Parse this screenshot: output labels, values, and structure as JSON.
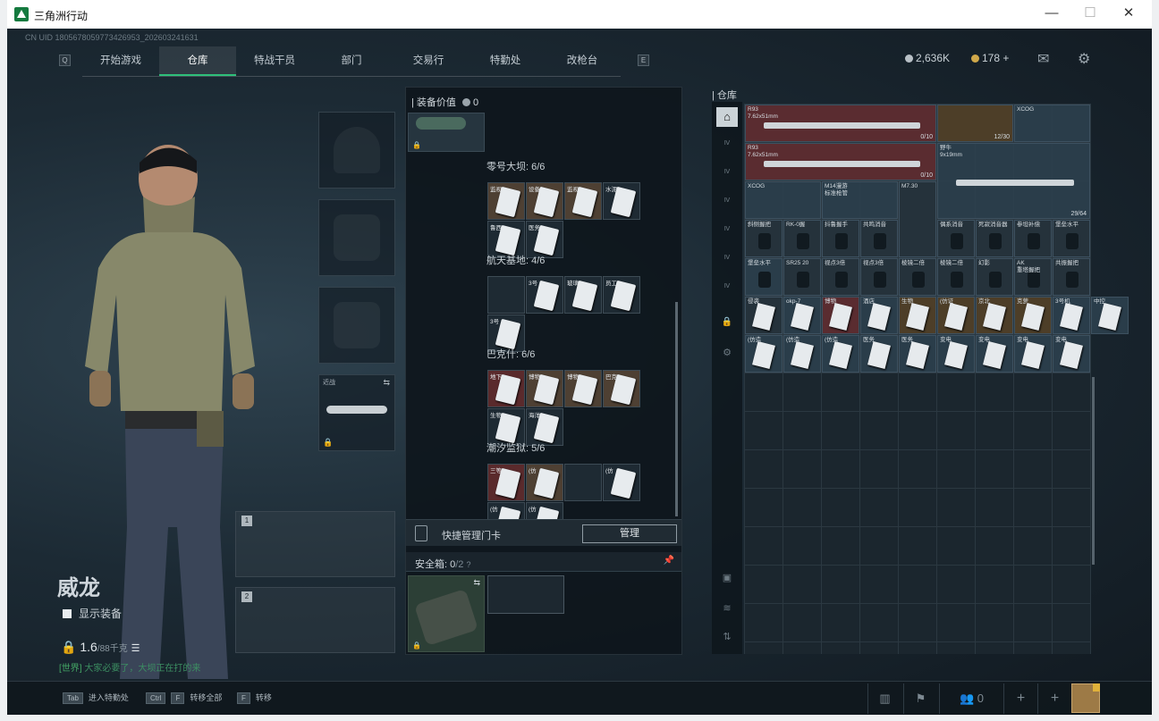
{
  "window": {
    "title": "三角洲行动",
    "min": "—",
    "max": "☐",
    "close": "✕"
  },
  "uid": "CN UID 1805678059773426953_202603241631",
  "nav": {
    "left_key": "Q",
    "right_key": "E",
    "tabs": [
      "开始游戏",
      "仓库",
      "特战干员",
      "部门",
      "交易行",
      "特勤处",
      "改枪台"
    ],
    "active": 1,
    "marked": [
      2,
      5
    ]
  },
  "currency": {
    "coins": "2,636K",
    "tokens": "178",
    "plus": "+"
  },
  "icons": {
    "mail": "mail-icon",
    "settings": "gear-icon"
  },
  "character": {
    "name": "威龙",
    "show_equipment": "显示装备",
    "weight": "1.6",
    "weight_max": "/88千克"
  },
  "chat": {
    "channel": "[世界]",
    "message": "大家必要了，大坝正在打的来"
  },
  "melee": {
    "label": "近战"
  },
  "weapon_slots": [
    "1",
    "2"
  ],
  "equip_value": {
    "label": "装备价值",
    "value": "0"
  },
  "key_sections": [
    {
      "title": "零号大坝: 6/6",
      "cards": [
        {
          "t": "监视",
          "c": "b"
        },
        {
          "t": "设备",
          "c": "b"
        },
        {
          "t": "监视",
          "c": "b"
        },
        {
          "t": "水泥",
          "c": "e"
        },
        {
          "t": "鲁西",
          "c": "e"
        },
        {
          "t": "医务",
          "c": "e"
        }
      ]
    },
    {
      "title": "航天基地: 4/6",
      "cards": [
        {
          "t": "",
          "c": "e"
        },
        {
          "t": "3号",
          "c": "e"
        },
        {
          "t": "玻璃",
          "c": "e"
        },
        {
          "t": "员工",
          "c": "e"
        },
        {
          "t": "3号",
          "c": "e"
        }
      ]
    },
    {
      "title": "巴克什: 6/6",
      "cards": [
        {
          "t": "地下",
          "c": "r"
        },
        {
          "t": "博物",
          "c": "b"
        },
        {
          "t": "博物",
          "c": "b"
        },
        {
          "t": "巴克",
          "c": "b"
        },
        {
          "t": "生物",
          "c": "e"
        },
        {
          "t": "海洋",
          "c": "e"
        }
      ]
    },
    {
      "title": "潮汐监狱: 5/6",
      "cards": [
        {
          "t": "三等",
          "c": "r"
        },
        {
          "t": "(仿",
          "c": "b"
        },
        {
          "t": "",
          "c": "e"
        },
        {
          "t": "(仿",
          "c": "e"
        },
        {
          "t": "(仿",
          "c": "e"
        },
        {
          "t": "(仿",
          "c": "e"
        }
      ]
    }
  ],
  "quick_keycards": {
    "label": "快捷管理门卡",
    "button": "管理"
  },
  "safe_box": {
    "label": "安全箱:",
    "value": "0",
    "max": "/2"
  },
  "warehouse": {
    "title": "仓库"
  },
  "items": [
    {
      "name": "R93\n7.62x51mm",
      "count": "0/10"
    },
    {
      "name": "",
      "count": "12/30"
    },
    {
      "name": "XCOG",
      "count": ""
    },
    {
      "name": "R93\n7.62x51mm",
      "count": "0/10"
    },
    {
      "name": "野牛\n9x19mm",
      "count": "29/64"
    },
    {
      "name": "XCOG",
      "count": ""
    },
    {
      "name": "M14漫游\n标准枪管",
      "count": ""
    },
    {
      "name": "M7.30",
      "count": ""
    },
    {
      "name": "斜侧握把",
      "count": ""
    },
    {
      "name": "RK-0握",
      "count": ""
    },
    {
      "name": "抖鲁握手",
      "count": ""
    },
    {
      "name": "共鸣消音",
      "count": ""
    },
    {
      "name": "偶系消音",
      "count": ""
    },
    {
      "name": "死寂消音器",
      "count": ""
    },
    {
      "name": "参坦补偿",
      "count": ""
    },
    {
      "name": "堡垒水平",
      "count": ""
    },
    {
      "name": "堡垒水平",
      "count": ""
    },
    {
      "name": "SR25 20",
      "count": ""
    },
    {
      "name": "视点3倍",
      "count": ""
    },
    {
      "name": "视点3倍",
      "count": ""
    },
    {
      "name": "棱镜二倍",
      "count": ""
    },
    {
      "name": "棱镜二倍",
      "count": ""
    },
    {
      "name": "幻影",
      "count": ""
    },
    {
      "name": "AK\n重塔握把",
      "count": ""
    },
    {
      "name": "共振握把",
      "count": ""
    },
    {
      "name": "侵袭",
      "count": ""
    },
    {
      "name": "okp-7",
      "count": ""
    },
    {
      "name": "博物",
      "count": ""
    },
    {
      "name": "酒店",
      "count": ""
    },
    {
      "name": "生物",
      "count": ""
    },
    {
      "name": "(仿证",
      "count": ""
    },
    {
      "name": "京北",
      "count": ""
    },
    {
      "name": "克萝",
      "count": ""
    },
    {
      "name": "3号机",
      "count": ""
    },
    {
      "name": "中控",
      "count": ""
    },
    {
      "name": "(仿造",
      "count": ""
    },
    {
      "name": "(仿造",
      "count": ""
    },
    {
      "name": "(仿造",
      "count": ""
    },
    {
      "name": "医务",
      "count": ""
    },
    {
      "name": "医务",
      "count": ""
    },
    {
      "name": "变电",
      "count": ""
    },
    {
      "name": "变电",
      "count": ""
    },
    {
      "name": "变电",
      "count": ""
    },
    {
      "name": "变电",
      "count": ""
    }
  ],
  "bottom": {
    "keys": [
      {
        "k": "Tab",
        "label": "进入特勤处"
      },
      {
        "k": "Ctrl",
        "k2": "F",
        "label": "转移全部"
      },
      {
        "k": "F",
        "label": "转移"
      }
    ],
    "friends": "0"
  }
}
